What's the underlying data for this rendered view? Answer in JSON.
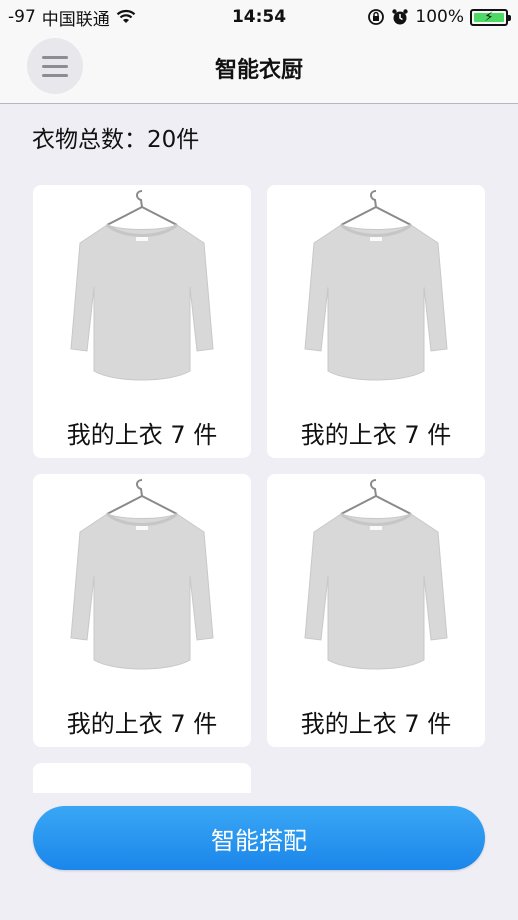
{
  "status_bar": {
    "signal": "-97",
    "carrier": "中国联通",
    "time": "14:54",
    "battery": "100%",
    "icons": [
      "wifi-icon",
      "orientation-lock-icon",
      "alarm-icon",
      "battery-icon"
    ],
    "battery_color": "#4cd964"
  },
  "nav": {
    "title": "智能衣厨",
    "menu_icon": "hamburger-menu-icon"
  },
  "summary": {
    "text": "衣物总数：20件"
  },
  "items": [
    {
      "label": "我的上衣 7 件",
      "image": "sweater-on-hanger"
    },
    {
      "label": "我的上衣 7 件",
      "image": "sweater-on-hanger"
    },
    {
      "label": "我的上衣 7 件",
      "image": "sweater-on-hanger"
    },
    {
      "label": "我的上衣 7 件",
      "image": "sweater-on-hanger"
    }
  ],
  "bottom_button": {
    "label": "智能搭配",
    "color": "#2196f0"
  }
}
